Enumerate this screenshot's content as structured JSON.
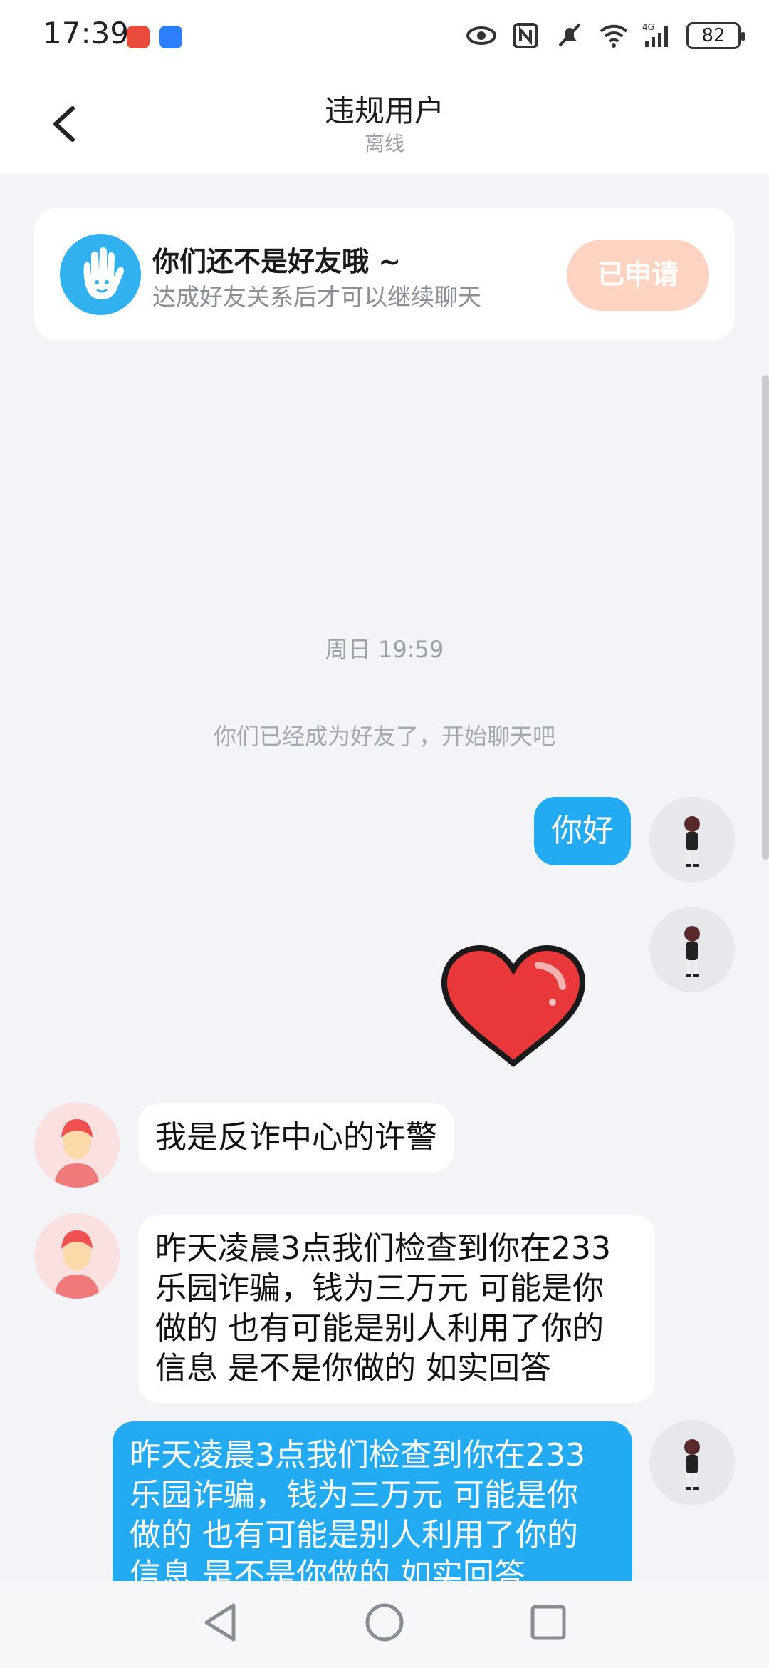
{
  "status_bar": {
    "time": "17:39",
    "battery": "82",
    "icons": [
      "eye-icon",
      "nfc-icon",
      "mute-icon",
      "wifi-icon",
      "signal-4g-icon",
      "battery-icon"
    ]
  },
  "header": {
    "title": "违规用户",
    "status": "离线"
  },
  "notice": {
    "title": "你们还不是好友哦 ~",
    "subtitle": "达成好友关系后才可以继续聊天",
    "button_label": "已申请",
    "colors": {
      "icon_bg": "#31b1ef",
      "button_bg": "#ffd3c1"
    }
  },
  "chat": {
    "timestamp": "周日 19:59",
    "system_message": "你们已经成为好友了，开始聊天吧",
    "messages": [
      {
        "sender": "me",
        "type": "text",
        "text": "你好"
      },
      {
        "sender": "me",
        "type": "sticker",
        "sticker": "heart"
      },
      {
        "sender": "other",
        "type": "text",
        "text": "我是反诈中心的许警"
      },
      {
        "sender": "other",
        "type": "text",
        "lines": [
          "昨天凌晨3点我们检查到你在233",
          "乐园诈骗，钱为三万元 可能是你",
          "做的 也有可能是别人利用了你的",
          "信息 是不是你做的 如实回答"
        ]
      },
      {
        "sender": "me",
        "type": "text",
        "lines": [
          "昨天凌晨3点我们检查到你在233",
          "乐园诈骗，钱为三万元 可能是你",
          "做的 也有可能是别人利用了你的",
          "信息 是不是你做的 如实回答"
        ]
      }
    ],
    "colors": {
      "my_bubble": "#22aaf2",
      "other_bubble": "#ffffff",
      "background": "#f2f4f8"
    }
  },
  "nav_bar": {
    "icons": [
      "nav-back-icon",
      "nav-home-icon",
      "nav-recents-icon"
    ]
  }
}
